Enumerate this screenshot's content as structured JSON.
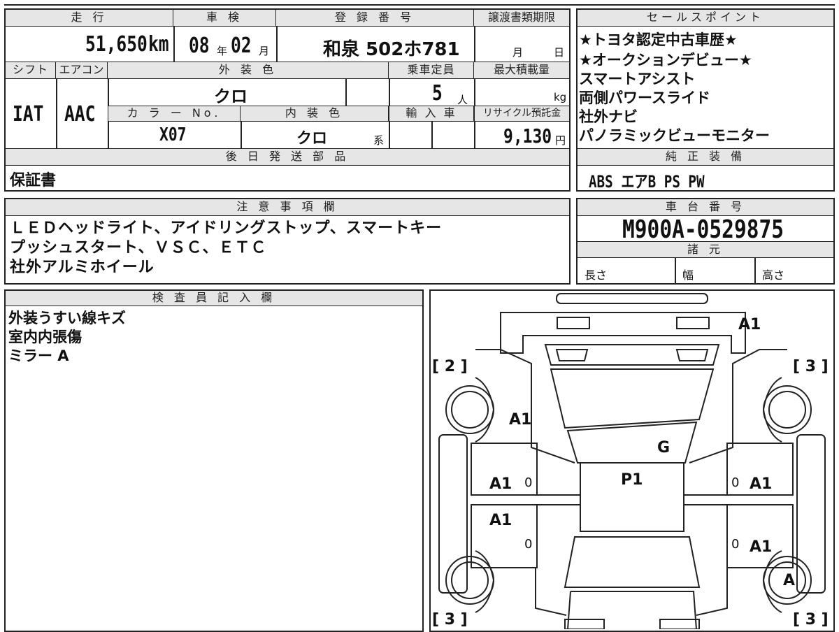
{
  "header": {
    "mileage_label": "走 行",
    "shaken_label": "車 検",
    "reg_label": "登 録 番 号",
    "transfer_label": "譲渡書類期限",
    "mileage": "51,650",
    "mileage_unit": "km",
    "shaken_year": "08",
    "year_unit": "年",
    "shaken_month": "02",
    "month_unit": "月",
    "reg_number": "和泉 502ホ781",
    "transfer_month_unit": "月",
    "transfer_day_unit": "日"
  },
  "specs": {
    "shift_label": "シフト",
    "aircon_label": "エアコン",
    "exterior_label": "外 装 色",
    "capacity_label": "乗車定員",
    "maxload_label": "最大積載量",
    "shift": "IAT",
    "aircon": "AAC",
    "exterior": "クロ",
    "capacity": "5",
    "capacity_unit": "人",
    "load_unit": "kg",
    "colorno_label": "カ ラ ー No.",
    "interior_label": "内 装 色",
    "import_label": "輸 入 車",
    "recycle_label": "リサイクル預託金",
    "colorno": "X07",
    "interior": "クロ",
    "interior_unit": "系",
    "recycle": "9,130",
    "recycle_unit": "円",
    "delivery_label": "後 日 発 送 部 品",
    "delivery": "保証書"
  },
  "sales": {
    "label": "セールスポイント",
    "lines": [
      "★トヨタ認定中古車歴★",
      "★オークションデビュー★",
      "スマートアシスト",
      "両側パワースライド",
      "社外ナビ",
      "パノラミックビューモニター"
    ]
  },
  "equipment": {
    "label": "純 正 装 備",
    "value": "ABS エアB PS PW"
  },
  "notes": {
    "label": "注 意 事 項 欄",
    "lines": [
      "ＬＥＤヘッドライト、アイドリングストップ、スマートキー",
      "プッシュスタート、ＶＳＣ、ＥＴＣ",
      "社外アルミホイール"
    ]
  },
  "chassis": {
    "label": "車 台 番 号",
    "value": "M900A-0529875",
    "dims_label": "諸 元",
    "length_label": "長さ",
    "width_label": "幅",
    "height_label": "高さ"
  },
  "inspector": {
    "label": "検 査 員 記 入 欄",
    "lines": [
      "外装うすい線キズ",
      "室内内張傷",
      "ミラー A"
    ]
  },
  "diagram": {
    "marks": {
      "rear_right": "A1",
      "rear_left_panel": "A1",
      "glass": "G",
      "roof": "P1",
      "left_rear_door": "A1",
      "left_front_door": "A1",
      "right_rear_door": "A1",
      "right_front_door": "A1",
      "front_right_wheel": "A",
      "zero_1": "0",
      "zero_2": "0",
      "zero_3": "0",
      "zero_4": "0"
    },
    "tires": {
      "rear_left": "[ 2 ]",
      "rear_right": "[ 3 ]",
      "front_left": "[ 3 ]",
      "front_right": "[ 3 ]"
    }
  }
}
